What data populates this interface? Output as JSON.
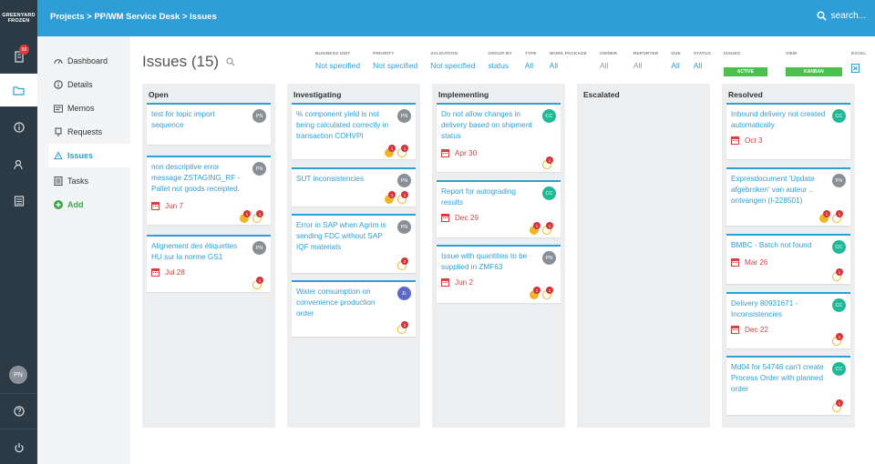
{
  "brand": {
    "line1": "GREENYARD",
    "line2": "FROZEN"
  },
  "rail": {
    "badge": "60",
    "avatar": "PN"
  },
  "header": {
    "crumbs": [
      "Projects",
      "PP/WM Service Desk",
      "Issues"
    ],
    "search_placeholder": "search..."
  },
  "nav": {
    "items": [
      {
        "label": "Dashboard",
        "icon": "gauge-icon"
      },
      {
        "label": "Details",
        "icon": "info-icon"
      },
      {
        "label": "Memos",
        "icon": "memo-icon"
      },
      {
        "label": "Requests",
        "icon": "request-icon"
      },
      {
        "label": "Issues",
        "icon": "warning-icon"
      },
      {
        "label": "Tasks",
        "icon": "tasks-icon"
      },
      {
        "label": "Add",
        "icon": "plus-icon"
      }
    ]
  },
  "page": {
    "title": "Issues (15)"
  },
  "filters": [
    {
      "label": "BUSINESS UNIT",
      "value": "Not specified"
    },
    {
      "label": "PRIORITY",
      "value": "Not specified"
    },
    {
      "label": "VALIDATION",
      "value": "Not specified"
    },
    {
      "label": "GROUP BY",
      "value": "status"
    },
    {
      "label": "TYPE",
      "value": "All"
    },
    {
      "label": "WORK PACKAGE",
      "value": "All"
    },
    {
      "label": "OWNER",
      "value": "All"
    },
    {
      "label": "REPORTER",
      "value": "All"
    },
    {
      "label": "DUE",
      "value": "All"
    },
    {
      "label": "STATUS",
      "value": "All"
    },
    {
      "label": "ISSUES",
      "value": "ACTIVE"
    },
    {
      "label": "VIEW",
      "value": "KANBAN"
    },
    {
      "label": "EXCEL",
      "value": ""
    }
  ],
  "columns": [
    {
      "title": "Open",
      "cards": [
        {
          "title": "test for topic import sequence",
          "avatar": "PN"
        },
        {
          "title": "non descriptive error message ZSTAGING_RF - Pallet not goods receipted.",
          "avatar": "PN",
          "due": "Jun 7",
          "c1": "1",
          "c2": "1"
        },
        {
          "title": "Alignement des étiquettes HU sur la norme GS1",
          "avatar": "PN",
          "due": "Jul 28",
          "c2": "1"
        }
      ]
    },
    {
      "title": "Investigating",
      "cards": [
        {
          "title": "% component yield is not being calculated correctly in transaction COHVPI",
          "avatar": "PN",
          "c1": "1",
          "c2": "1"
        },
        {
          "title": "SUT inconsistencies",
          "avatar": "PN",
          "c1": "1",
          "c2": "1"
        },
        {
          "title": "Error in SAP when Agrim is sending FDC without SAP IQF materials",
          "avatar": "PN",
          "c2": "2"
        },
        {
          "title": "Water consumption on convenience production order",
          "avatar": "JL",
          "c2": "2"
        }
      ]
    },
    {
      "title": "Implementing",
      "cards": [
        {
          "title": "Do not allow changes in delivery based on shipment status",
          "avatar": "CC",
          "due": "Apr 30",
          "c2": "1"
        },
        {
          "title": "Report for autograding results",
          "avatar": "CC",
          "due": "Dec 29",
          "c1": "1",
          "c2": "1"
        },
        {
          "title": "Issue with quantities to be supplied in ZMF63",
          "avatar": "PN",
          "due": "Jun 2",
          "c1": "1",
          "c2": "1"
        }
      ]
    },
    {
      "title": "Escalated",
      "cards": []
    },
    {
      "title": "Resolved",
      "cards": [
        {
          "title": "Inbound delivery not created automatically",
          "avatar": "CC",
          "due": "Oct 3"
        },
        {
          "title": "Expresdocument 'Update afgebroken' van auteur .. ontvangen (I-228501)",
          "avatar": "PN",
          "c1": "1",
          "c2": "1"
        },
        {
          "title": "BMBC - Batch not found",
          "avatar": "CC",
          "due": "Mar 26",
          "c2": "1"
        },
        {
          "title": "Delivery 80931671 - Inconsistencies",
          "avatar": "CC",
          "due": "Dec 22",
          "c2": "1"
        },
        {
          "title": "Md04 for 54748 can't create Process Order with planned order",
          "avatar": "CC",
          "c2": "1"
        }
      ]
    }
  ],
  "colors": {
    "accent": "#2e9fd6",
    "rail": "#2c3a45",
    "active_pill": "#4cc04c",
    "due": "#d64040"
  }
}
